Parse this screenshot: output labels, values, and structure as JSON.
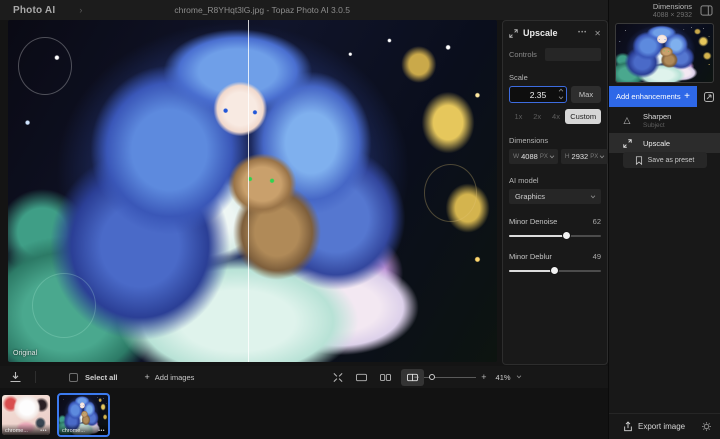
{
  "app": {
    "name": "Photo AI",
    "title": "chrome_R8YHqt3lG.jpg - Topaz Photo AI 3.0.5"
  },
  "header": {
    "dimensions_label": "Dimensions",
    "dimensions_value": "4088 × 2932"
  },
  "canvas": {
    "original_label": "Original"
  },
  "upscale_panel": {
    "title": "Upscale",
    "controls_label": "Controls",
    "scale_label": "Scale",
    "scale_value": "2.35",
    "max_label": "Max",
    "scale_options": {
      "x1": "1x",
      "x2": "2x",
      "x4": "4x",
      "custom": "Custom"
    },
    "dimensions_label": "Dimensions",
    "width_label": "W",
    "width_value": "4088",
    "height_label": "H",
    "height_value": "2932",
    "unit": "PX",
    "ai_model_label": "AI model",
    "ai_model_value": "Graphics",
    "denoise": {
      "label": "Minor Denoise",
      "value": 62
    },
    "deblur": {
      "label": "Minor Deblur",
      "value": 49
    }
  },
  "enhancements": {
    "add_label": "Add enhancements",
    "sharpen_label": "Sharpen",
    "sharpen_sublabel": "Subject",
    "upscale_label": "Upscale",
    "save_preset_label": "Save as preset"
  },
  "toolbar": {
    "select_all_label": "Select all",
    "add_images_label": "Add images",
    "zoom_value": "41%"
  },
  "filmstrip": {
    "items": [
      {
        "label": "chrome..."
      },
      {
        "label": "chrome..."
      }
    ]
  },
  "footer": {
    "export_label": "Export image"
  },
  "icons": {
    "ellipsis": "•••",
    "close": "✕",
    "plus": "+",
    "minus": "−",
    "triangle": "△",
    "chevron": "›",
    "menu_dots": "•••"
  },
  "colors": {
    "accent_blue": "#2e68e8",
    "selected_border": "#3c7bf0"
  }
}
